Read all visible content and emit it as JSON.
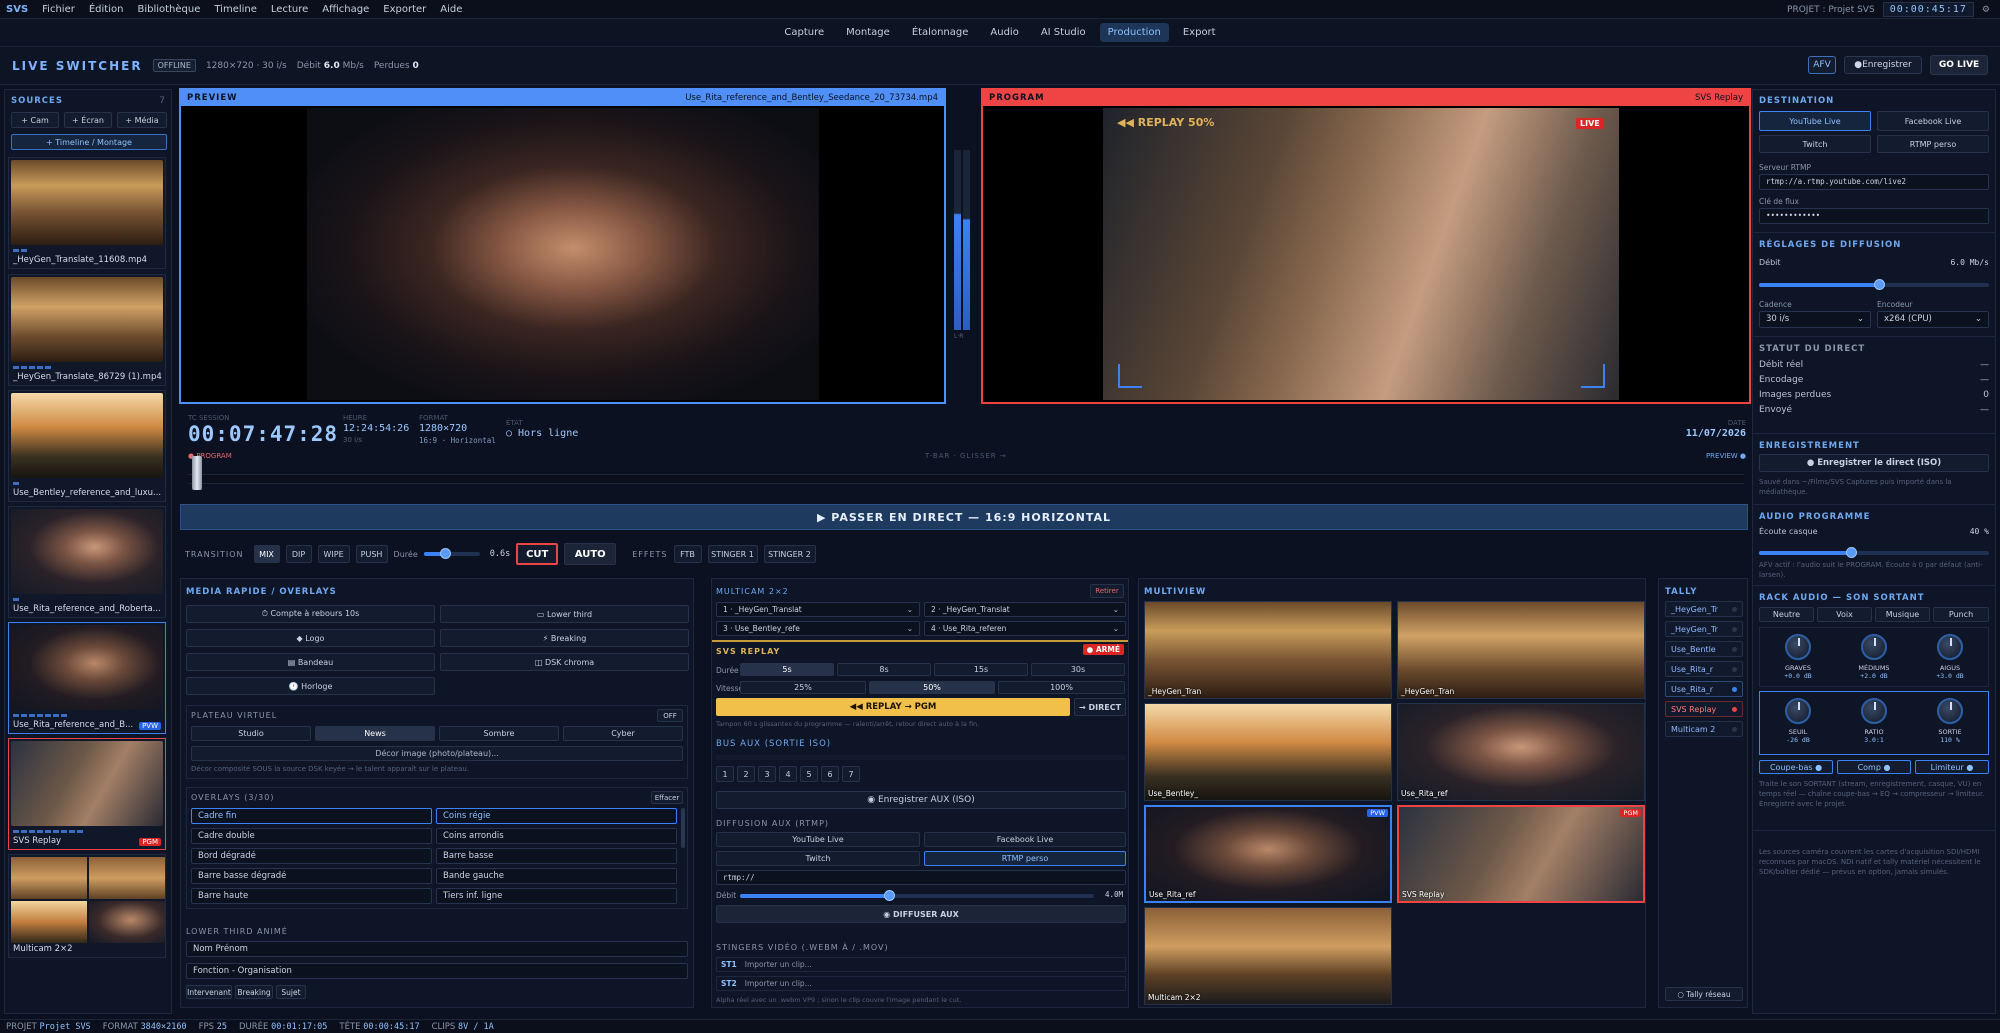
{
  "menubar": {
    "brand": "SVS",
    "items": [
      "Fichier",
      "Édition",
      "Bibliothèque",
      "Timeline",
      "Lecture",
      "Affichage",
      "Exporter",
      "Aide"
    ],
    "project": "PROJET : Projet SVS",
    "timecode": "00:00:45:17"
  },
  "tabs": [
    {
      "label": "Capture"
    },
    {
      "label": "Montage"
    },
    {
      "label": "Étalonnage"
    },
    {
      "label": "Audio"
    },
    {
      "label": "AI Studio"
    },
    {
      "label": "Production",
      "active": true
    },
    {
      "label": "Export"
    }
  ],
  "switcher": {
    "title": "LIVE SWITCHER",
    "status": "OFFLINE",
    "format": "1280×720 · 30 i/s",
    "bitrate_label": "Débit",
    "bitrate": "6.0",
    "bitrate_unit": "Mb/s",
    "lost_label": "Perdues",
    "lost": "0",
    "afv": "AFV",
    "record": "Enregistrer",
    "golive": "GO LIVE"
  },
  "sources": {
    "title": "SOURCES",
    "count": "7",
    "add_cam": "+ Cam",
    "add_screen": "+ Écran",
    "add_media": "+ Média",
    "timeline": "+ Timeline / Montage",
    "items": [
      {
        "label": "_HeyGen_Translate_11608.mp4"
      },
      {
        "label": "_HeyGen_Translate_86729 (1).mp4"
      },
      {
        "label": "Use_Bentley_reference_and_luxu..."
      },
      {
        "label": "Use_Rita_reference_and_Roberta..."
      },
      {
        "label": "Use_Rita_reference_and_B...",
        "tag": "PVW"
      },
      {
        "label": "SVS Replay",
        "tag": "PGM"
      },
      {
        "label": "Multicam 2×2"
      }
    ]
  },
  "preview": {
    "title": "PREVIEW",
    "source": "Use_Rita_reference_and_Bentley_Seedance_20_73734.mp4"
  },
  "program": {
    "title": "PROGRAM",
    "source": "SVS Replay",
    "replay": "◀◀ REPLAY 50%",
    "live": "LIVE"
  },
  "meter_label": "L·R",
  "session": {
    "tc_label": "TC SESSION",
    "tc": "00:07:47:28",
    "time_label": "HEURE",
    "time": "12:24:54:26",
    "fps": "30 i/s",
    "format_label": "FORMAT",
    "format": "1280×720",
    "aspect": "16:9 · Horizontal",
    "state_label": "ÉTAT",
    "state": "○ Hors ligne",
    "date_label": "DATE",
    "date": "11/07/2026"
  },
  "tbar": {
    "left": "● PROGRAM",
    "center": "T-BAR · GLISSER →",
    "right": "PREVIEW ●"
  },
  "golive_bar": "▶ PASSER EN DIRECT — 16:9 HORIZONTAL",
  "transition": {
    "label": "TRANSITION",
    "modes": [
      "MIX",
      "DIP",
      "WIPE",
      "PUSH"
    ],
    "duration_label": "Durée",
    "duration": "0.6s",
    "duration_level": 0.38,
    "cut": "CUT",
    "auto": "AUTO",
    "effects_label": "EFFETS",
    "effects": [
      "FTB",
      "STINGER 1",
      "STINGER 2"
    ]
  },
  "media": {
    "title": "MEDIA RAPIDE / OVERLAYS",
    "buttons": [
      "⏱ Compte à rebours 10s",
      "▭ Lower third",
      "◆ Logo",
      "⚡ Breaking",
      "▤ Bandeau",
      "◫ DSK chroma",
      "🕐 Horloge"
    ],
    "plateau": {
      "title": "PLATEAU VIRTUEL",
      "state": "OFF",
      "options": [
        "Studio",
        "News",
        "Sombre",
        "Cyber"
      ],
      "decor": "Décor image (photo/plateau)...",
      "note": "Décor composité SOUS la source DSK keyée → le talent apparaît sur le plateau."
    },
    "overlays": {
      "title": "OVERLAYS (3/30)",
      "clear": "Effacer",
      "items": [
        "Cadre fin",
        "Coins régie",
        "Cadre double",
        "Coins arrondis",
        "Bord dégradé",
        "Barre basse",
        "Barre basse dégradé",
        "Bande gauche",
        "Barre haute",
        "Tiers inf. ligne"
      ]
    },
    "lowerthird": {
      "title": "LOWER THIRD ANIMÉ",
      "name": "Nom Prénom",
      "role": "Fonction - Organisation",
      "styles": [
        "Intervenant",
        "Breaking",
        "Sujet"
      ]
    }
  },
  "multicam": {
    "title": "MULTICAM 2×2",
    "remove": "Retirer",
    "slots": [
      "1 · _HeyGen_Translat",
      "2 · _HeyGen_Translat",
      "3 · Use_Bentley_refe",
      "4 · Use_Rita_referen"
    ]
  },
  "replay": {
    "title": "SVS REPLAY",
    "armed": "● ARMÉ",
    "dur_label": "Durée",
    "durations": [
      "5s",
      "8s",
      "15s",
      "30s"
    ],
    "speed_label": "Vitesse",
    "speeds": [
      "25%",
      "50%",
      "100%"
    ],
    "go": "◀◀ REPLAY → PGM",
    "direct": "→ DIRECT",
    "note": "Tampon 60 s glissantes du programme — ralenti/arrêt, retour direct auto à la fin."
  },
  "bus": {
    "title": "BUS AUX (SORTIE ISO)",
    "nums": [
      "1",
      "2",
      "3",
      "4",
      "5",
      "6",
      "7"
    ],
    "record": "◉ Enregistrer AUX (ISO)",
    "diff_title": "DIFFUSION AUX (RTMP)",
    "dest": [
      "YouTube Live",
      "Facebook Live",
      "Twitch",
      "RTMP perso"
    ],
    "url": "rtmp://",
    "rate_label": "Débit",
    "rate": "4.0M",
    "rate_level": 0.42,
    "broadcast": "◉ DIFFUSER AUX"
  },
  "stingers": {
    "title": "STINGERS VIDÉO (.WEBM À / .MOV)",
    "items": [
      {
        "k": "ST1",
        "v": "Importer un clip..."
      },
      {
        "k": "ST2",
        "v": "Importer un clip..."
      }
    ],
    "note": "Alpha réel avec un .webm VP9 ; sinon le clip couvre l'image pendant le cut."
  },
  "multiview": {
    "title": "MULTIVIEW",
    "tiles": [
      {
        "label": "_HeyGen_Tran"
      },
      {
        "label": "_HeyGen_Tran"
      },
      {
        "label": "Use_Bentley_"
      },
      {
        "label": "Use_Rita_ref"
      },
      {
        "label": "Use_Rita_ref",
        "tag": "PVW"
      },
      {
        "label": "SVS Replay",
        "tag": "PGM"
      },
      {
        "label": "Multicam 2×2"
      }
    ]
  },
  "tally": {
    "title": "TALLY",
    "items": [
      "_HeyGen_Tr",
      "_HeyGen_Tr",
      "Use_Bentle",
      "Use_Rita_r",
      "Use_Rita_r",
      "SVS Replay",
      "Multicam 2"
    ],
    "net": "○ Tally réseau"
  },
  "dest": {
    "title": "DESTINATION",
    "options": [
      "YouTube Live",
      "Facebook Live",
      "Twitch",
      "RTMP perso"
    ],
    "server_label": "Serveur RTMP",
    "server": "rtmp://a.rtmp.youtube.com/live2",
    "key_label": "Clé de flux",
    "key": "••••••••••••"
  },
  "settings": {
    "title": "RÉGLAGES DE DIFFUSION",
    "rate_label": "Débit",
    "rate": "6.0 Mb/s",
    "rate_level": 0.52,
    "cad_label": "Cadence",
    "cad": "30 i/s",
    "enc_label": "Encodeur",
    "enc": "x264 (CPU)"
  },
  "status": {
    "title": "STATUT DU DIRECT",
    "rows": [
      {
        "k": "Débit réel",
        "v": "—"
      },
      {
        "k": "Encodage",
        "v": "—"
      },
      {
        "k": "Images perdues",
        "v": "0"
      },
      {
        "k": "Envoyé",
        "v": "—"
      }
    ]
  },
  "recording": {
    "title": "ENREGISTREMENT",
    "button": "● Enregistrer le direct (ISO)",
    "note": "Sauvé dans ~/Films/SVS Captures puis importé dans la médiathèque."
  },
  "audio": {
    "title": "AUDIO PROGRAMME",
    "label": "Écoute casque",
    "value": "40 %",
    "level": 0.4,
    "note": "AFV actif : l'audio suit le PROGRAM. Écoute à 0 par défaut (anti-larsen)."
  },
  "rack": {
    "title": "RACK AUDIO — SON SORTANT",
    "presets": [
      "Neutre",
      "Voix",
      "Musique",
      "Punch"
    ],
    "eq": [
      {
        "k": "GRAVES",
        "v": "+0.0 dB"
      },
      {
        "k": "MÉDIUMS",
        "v": "+2.0 dB"
      },
      {
        "k": "AIGUS",
        "v": "+3.0 dB"
      }
    ],
    "comp": [
      {
        "k": "SEUIL",
        "v": "-26 dB"
      },
      {
        "k": "RATIO",
        "v": "3.0:1"
      },
      {
        "k": "SORTIE",
        "v": "110 %"
      }
    ],
    "toggles": [
      "Coupe-bas ●",
      "Comp ●",
      "Limiteur ●"
    ],
    "note": "Traite le son SORTANT (stream, enregistrement, casque, VU) en temps réel — chaîne coupe-bas → EQ → compresseur → limiteur. Enregistré avec le projet.",
    "footnote": "Les sources caméra couvrent les cartes d'acquisition SDI/HDMI reconnues par macOS. NDI natif et tally matériel nécessitent le SDK/boîtier dédié — prévus en option, jamais simulés."
  },
  "statusbar": {
    "proj_label": "PROJET",
    "proj": "Projet SVS",
    "fmt_label": "FORMAT",
    "fmt": "3840×2160",
    "fps_label": "FPS",
    "fps": "25",
    "dur_label": "DURÉE",
    "dur": "00:01:17:05",
    "head_label": "TÊTE",
    "head": "00:00:45:17",
    "clips_label": "CLIPS",
    "clips": "8V / 1A"
  }
}
